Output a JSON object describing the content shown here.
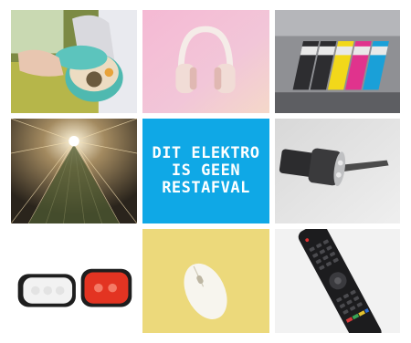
{
  "slogan": {
    "lines": [
      "DIT ELEKTRO",
      "IS GEEN",
      "RESTAFVAL"
    ],
    "background": "#0fa8e6",
    "text_color": "#ffffff"
  },
  "tiles": [
    {
      "icon": "toy-camera-icon"
    },
    {
      "icon": "headphones-icon"
    },
    {
      "icon": "ink-cartridges-icon"
    },
    {
      "icon": "christmas-lights-icon"
    },
    {
      "icon": "slogan"
    },
    {
      "icon": "flashlight-icon"
    },
    {
      "icon": "bike-lights-icon"
    },
    {
      "icon": "computer-mouse-icon"
    },
    {
      "icon": "remote-control-icon"
    }
  ]
}
